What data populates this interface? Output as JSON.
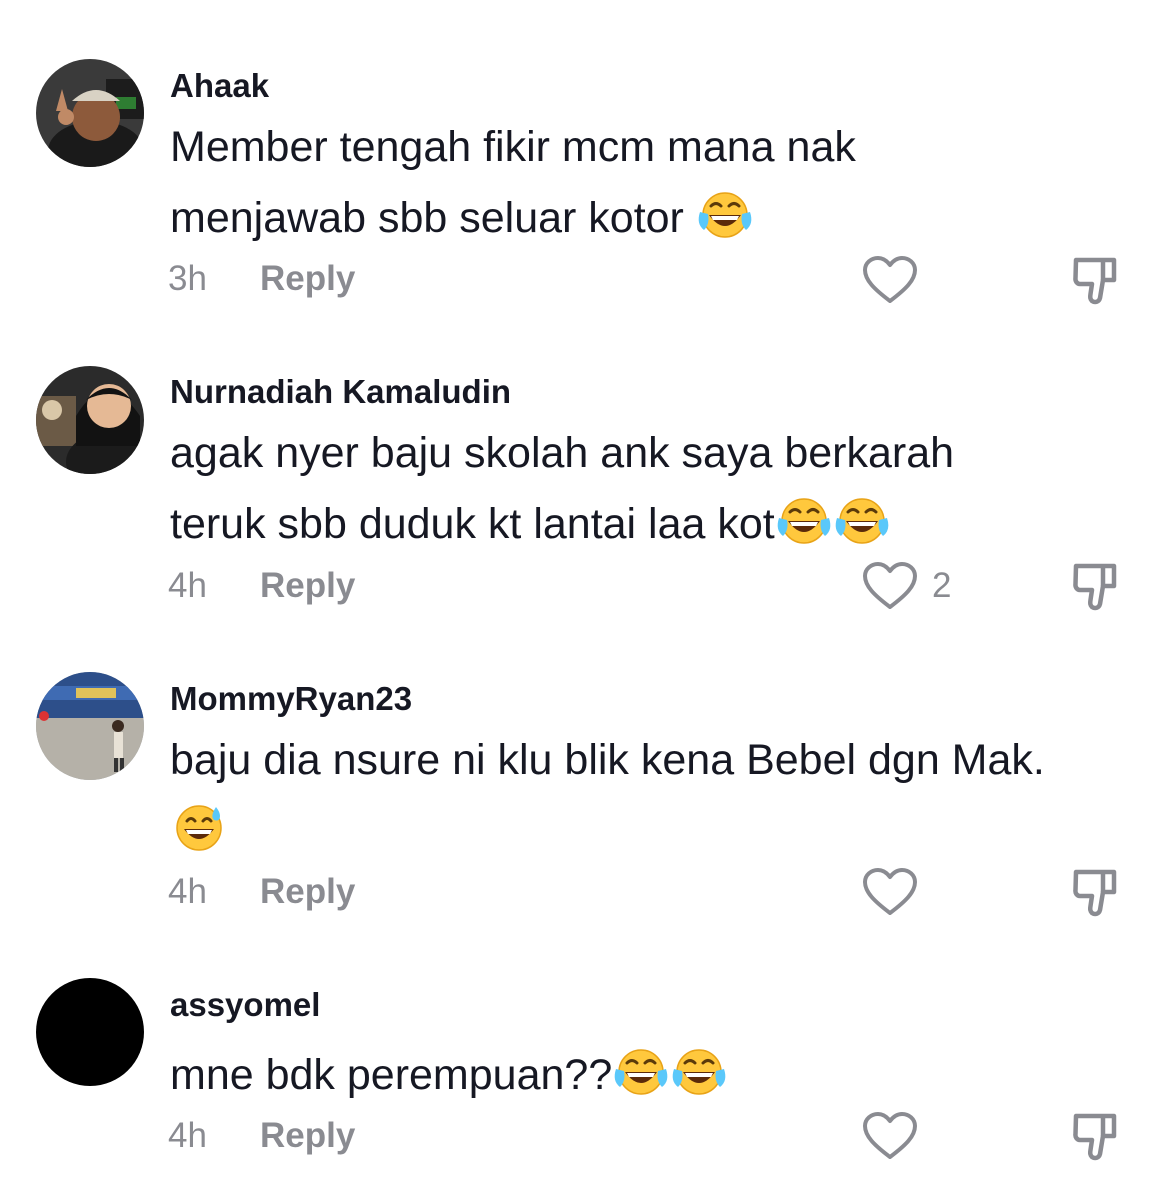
{
  "comments": [
    {
      "username": "Ahaak",
      "text": "Member tengah fikir mcm mana nak menjawab sbb seluar kotor",
      "emoji": "face-with-tears-of-joy",
      "time": "3h",
      "reply_label": "Reply",
      "like_count": ""
    },
    {
      "username": "Nurnadiah Kamaludin",
      "text": "agak nyer baju skolah ank saya berkarah teruk sbb duduk kt lantai laa kot",
      "emoji": "face-with-tears-of-joy x2",
      "time": "4h",
      "reply_label": "Reply",
      "like_count": "2"
    },
    {
      "username": "MommyRyan23",
      "text": "baju dia nsure ni klu blik kena Bebel dgn Mak.",
      "emoji": "grinning-face-with-sweat",
      "time": "4h",
      "reply_label": "Reply",
      "like_count": ""
    },
    {
      "username": "assyomel",
      "text": "mne bdk perempuan??",
      "emoji": "face-with-tears-of-joy x2",
      "time": "4h",
      "reply_label": "Reply",
      "like_count": ""
    }
  ],
  "icons": {
    "like": "heart-outline-icon",
    "dislike": "thumbs-down-outline-icon"
  },
  "colors": {
    "text": "#161823",
    "meta": "#8a8b91",
    "background": "#ffffff"
  }
}
